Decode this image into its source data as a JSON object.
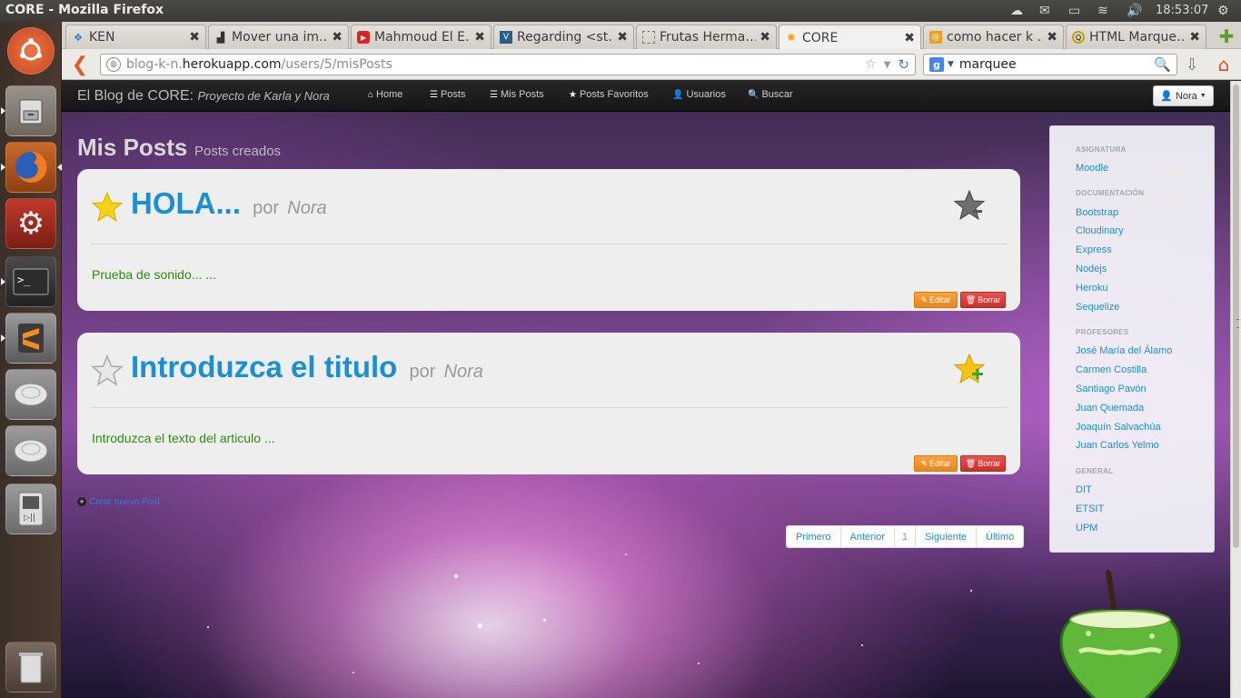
{
  "os": {
    "window_title": "CORE - Mozilla Firefox",
    "clock": "18:53:07"
  },
  "browser": {
    "tabs": [
      {
        "label": "KEN",
        "active": false
      },
      {
        "label": "Mover una im…",
        "active": false
      },
      {
        "label": "Mahmoud El E…",
        "active": false
      },
      {
        "label": "Regarding <st…",
        "active": false
      },
      {
        "label": "Frutas Herma…",
        "active": false
      },
      {
        "label": "CORE",
        "active": true
      },
      {
        "label": "como hacer k …",
        "active": false
      },
      {
        "label": "HTML Marque…",
        "active": false
      }
    ],
    "url_prefix": "blog-k-n.",
    "url_domain": "herokuapp.com",
    "url_path": "/users/5/misPosts",
    "search_query": "marquee"
  },
  "site": {
    "brand": "El Blog de CORE:",
    "brand_subtitle": "Proyecto de Karla y Nora",
    "nav": {
      "home": "Home",
      "posts": "Posts",
      "my_posts": "Mis Posts",
      "favorites": "Posts Favoritos",
      "users": "Usuarios",
      "search": "Buscar"
    },
    "user_button": "Nora"
  },
  "page": {
    "title": "Mis Posts",
    "subtitle": "Posts creados",
    "posts": [
      {
        "title": "HOLA...",
        "por": "por",
        "author": "Nora",
        "body": "Prueba de sonido... ...",
        "favorite": true,
        "edit_label": "Editar",
        "delete_label": "Borrar"
      },
      {
        "title": "Introduzca el titulo",
        "por": "por",
        "author": "Nora",
        "body": "Introduzca el texto del articulo ...",
        "favorite": false,
        "edit_label": "Editar",
        "delete_label": "Borrar"
      }
    ],
    "new_post_label": "Crear nuevo Post",
    "pagination": {
      "first": "Primero",
      "prev": "Anterior",
      "current": "1",
      "next": "Siguiente",
      "last": "Último"
    }
  },
  "sidebar": {
    "section_subject": "ASIGNATURA",
    "subject_links": [
      "Moodle"
    ],
    "section_docs": "DOCUMENTACIÓN",
    "doc_links": [
      "Bootstrap",
      "Cloudinary",
      "Express",
      "Nodejs",
      "Heroku",
      "Sequelize"
    ],
    "section_teachers": "PROFESORES",
    "teacher_links": [
      "José María del Álamo",
      "Carmen Costilla",
      "Santiago Pavón",
      "Juan Quemada",
      "Joaquín Salvachúa",
      "Juan Carlos Yelmo"
    ],
    "section_general": "GENERAL",
    "general_links": [
      "DIT",
      "ETSIT",
      "UPM"
    ]
  },
  "colors": {
    "link": "#1a8fd1",
    "body_text": "#2e8b0e",
    "edit_button": "#f0952a",
    "delete_button": "#d9534f"
  }
}
